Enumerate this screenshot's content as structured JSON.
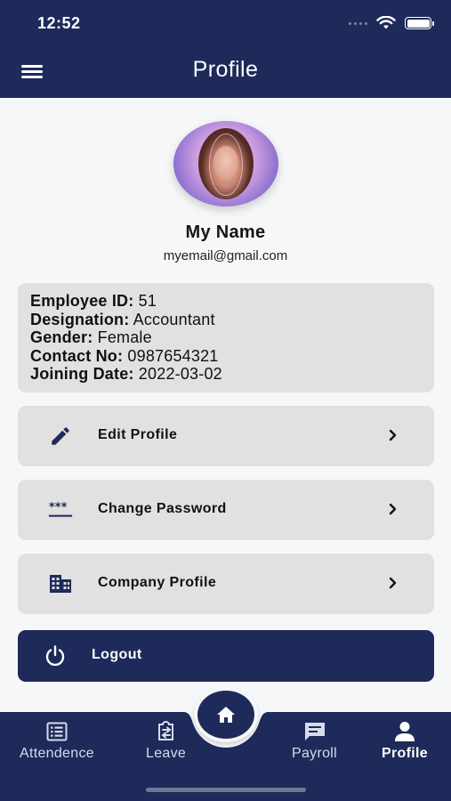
{
  "status_bar": {
    "time": "12:52"
  },
  "header": {
    "title": "Profile"
  },
  "user": {
    "name": "My Name",
    "email": "myemail@gmail.com"
  },
  "info": [
    {
      "key": "Employee ID:",
      "value": " 51"
    },
    {
      "key": "Designation:",
      "value": " Accountant"
    },
    {
      "key": "Gender:",
      "value": " Female"
    },
    {
      "key": "Contact No:",
      "value": " 0987654321"
    },
    {
      "key": "Joining Date:",
      "value": " 2022-03-02"
    }
  ],
  "actions": [
    {
      "label": "Edit Profile",
      "icon": "pencil-icon"
    },
    {
      "label": "Change Password",
      "icon": "password-icon"
    },
    {
      "label": "Company Profile",
      "icon": "building-icon"
    }
  ],
  "logout": {
    "label": "Logout",
    "icon": "power-icon"
  },
  "bottom_nav": {
    "items": [
      {
        "label": "Attendence",
        "icon": "list-icon"
      },
      {
        "label": "Leave",
        "icon": "clipboard-transfer-icon"
      },
      {
        "label": "Payroll",
        "icon": "chat-icon"
      },
      {
        "label": "Profile",
        "icon": "person-icon",
        "active": true
      }
    ],
    "home_icon": "home-icon"
  },
  "colors": {
    "primary": "#1e2a5a",
    "card": "#e1e1e1",
    "background": "#f6f7f9"
  }
}
